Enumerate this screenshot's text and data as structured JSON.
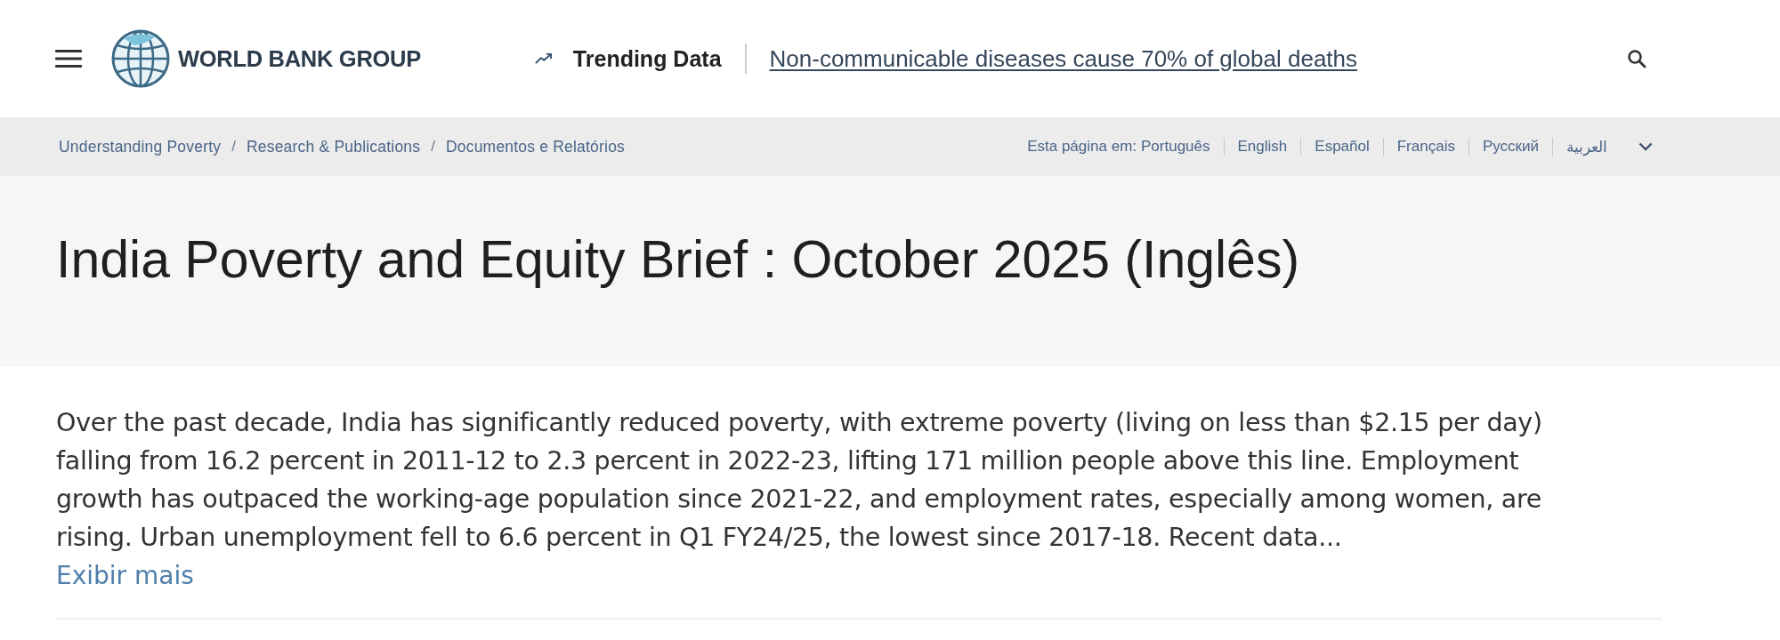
{
  "header": {
    "logo_text": "WORLD BANK GROUP",
    "trending": {
      "label": "Trending Data",
      "link": "Non-communicable diseases cause 70% of global deaths"
    }
  },
  "breadcrumbs": {
    "separator": "/",
    "items": [
      "Understanding Poverty",
      "Research & Publications",
      "Documentos e Relatórios"
    ]
  },
  "languages": {
    "label": "Esta página em:",
    "items": [
      "Português",
      "English",
      "Español",
      "Français",
      "Русский",
      "العربية"
    ]
  },
  "title": "India Poverty and Equity Brief : October 2025 (Inglês)",
  "summary": {
    "text": "Over the past decade, India has significantly reduced poverty, with extreme poverty (living on less than $2.15 per day) falling from 16.2 percent in 2011-12 to 2.3 percent in 2022-23, lifting 171 million people above this line. Employment growth has outpaced the working-age population since 2021-22, and employment rates, especially among women, are rising. Urban unemployment fell to 6.6 percent in Q1 FY24/25, the lowest since 2017-18. Recent data...",
    "more_link": "Exibir mais"
  }
}
